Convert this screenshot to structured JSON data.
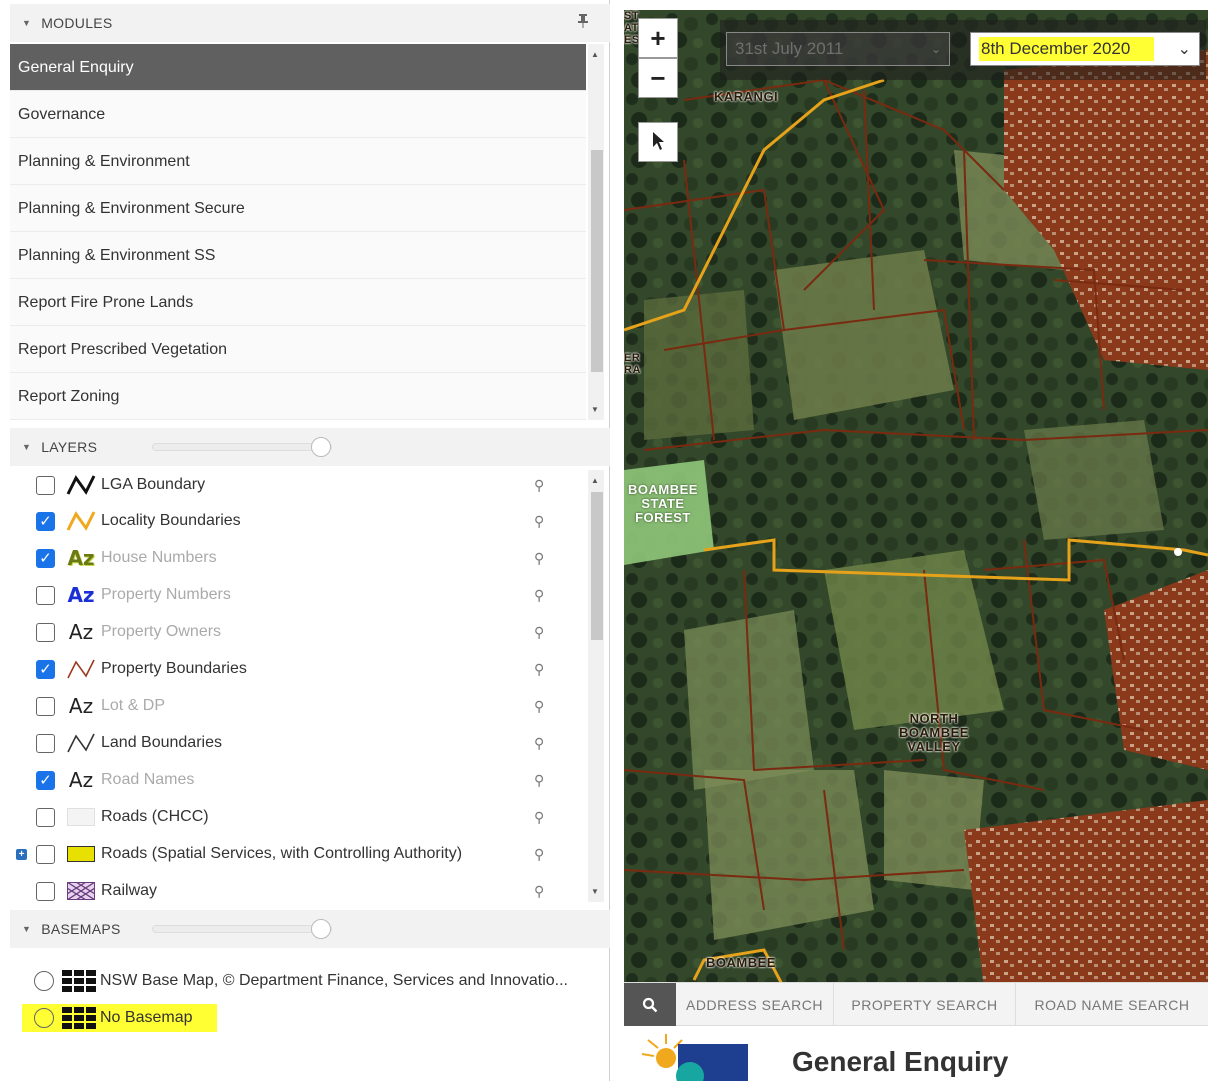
{
  "modules": {
    "header": "MODULES",
    "items": [
      {
        "label": "General Enquiry",
        "active": true
      },
      {
        "label": "Governance",
        "active": false
      },
      {
        "label": "Planning & Environment",
        "active": false
      },
      {
        "label": "Planning & Environment Secure",
        "active": false
      },
      {
        "label": "Planning & Environment SS",
        "active": false
      },
      {
        "label": "Report Fire Prone Lands",
        "active": false
      },
      {
        "label": "Report Prescribed Vegetation",
        "active": false
      },
      {
        "label": "Report Zoning",
        "active": false
      }
    ]
  },
  "layers": {
    "header": "LAYERS",
    "opacity_percent": 100,
    "items": [
      {
        "label": "LGA Boundary",
        "checked": false,
        "enabled": true,
        "icon": "line-black-icon"
      },
      {
        "label": "Locality Boundaries",
        "checked": true,
        "enabled": true,
        "icon": "line-orange-icon"
      },
      {
        "label": "House Numbers",
        "checked": true,
        "enabled": false,
        "icon": "az-green-icon"
      },
      {
        "label": "Property Numbers",
        "checked": false,
        "enabled": false,
        "icon": "az-blue-icon"
      },
      {
        "label": "Property Owners",
        "checked": false,
        "enabled": false,
        "icon": "az-black-icon"
      },
      {
        "label": "Property Boundaries",
        "checked": true,
        "enabled": true,
        "icon": "line-brown-icon"
      },
      {
        "label": "Lot & DP",
        "checked": false,
        "enabled": false,
        "icon": "az-black-icon"
      },
      {
        "label": "Land Boundaries",
        "checked": false,
        "enabled": true,
        "icon": "line-thin-icon"
      },
      {
        "label": "Road Names",
        "checked": true,
        "enabled": false,
        "icon": "az-black-icon"
      },
      {
        "label": "Roads (CHCC)",
        "checked": false,
        "enabled": true,
        "icon": "swatch-white-icon"
      },
      {
        "label": "Roads (Spatial Services, with Controlling Authority)",
        "checked": false,
        "enabled": true,
        "icon": "swatch-yellow-icon",
        "expandable": true
      },
      {
        "label": "Railway",
        "checked": false,
        "enabled": true,
        "icon": "railway-pattern-icon"
      }
    ]
  },
  "basemaps": {
    "header": "BASEMAPS",
    "opacity_percent": 100,
    "items": [
      {
        "label": "NSW Base Map, © Department Finance, Services and Innovatio...",
        "highlighted": false
      },
      {
        "label": "No Basemap",
        "highlighted": true
      }
    ]
  },
  "map": {
    "zoom_in": "+",
    "zoom_out": "−",
    "date_from": "31st July 2011",
    "date_to": "8th December 2020",
    "labels": {
      "karangi": "KARANGI",
      "boambee_forest": "BOAMBEE\nSTATE\nFOREST",
      "north_boambee": "NORTH\nBOAMBEE\nVALLEY",
      "boambee": "BOAMBEE",
      "edge_top": "ST\nATE\nES",
      "edge_mid": "ER\nRA"
    },
    "colors": {
      "boundary": "#7a2a10",
      "locality": "#e5a21a",
      "highlight": "#ffff33"
    }
  },
  "search": {
    "tabs": [
      "ADDRESS SEARCH",
      "PROPERTY SEARCH",
      "ROAD NAME SEARCH"
    ]
  },
  "enquiry": {
    "title": "General Enquiry"
  }
}
